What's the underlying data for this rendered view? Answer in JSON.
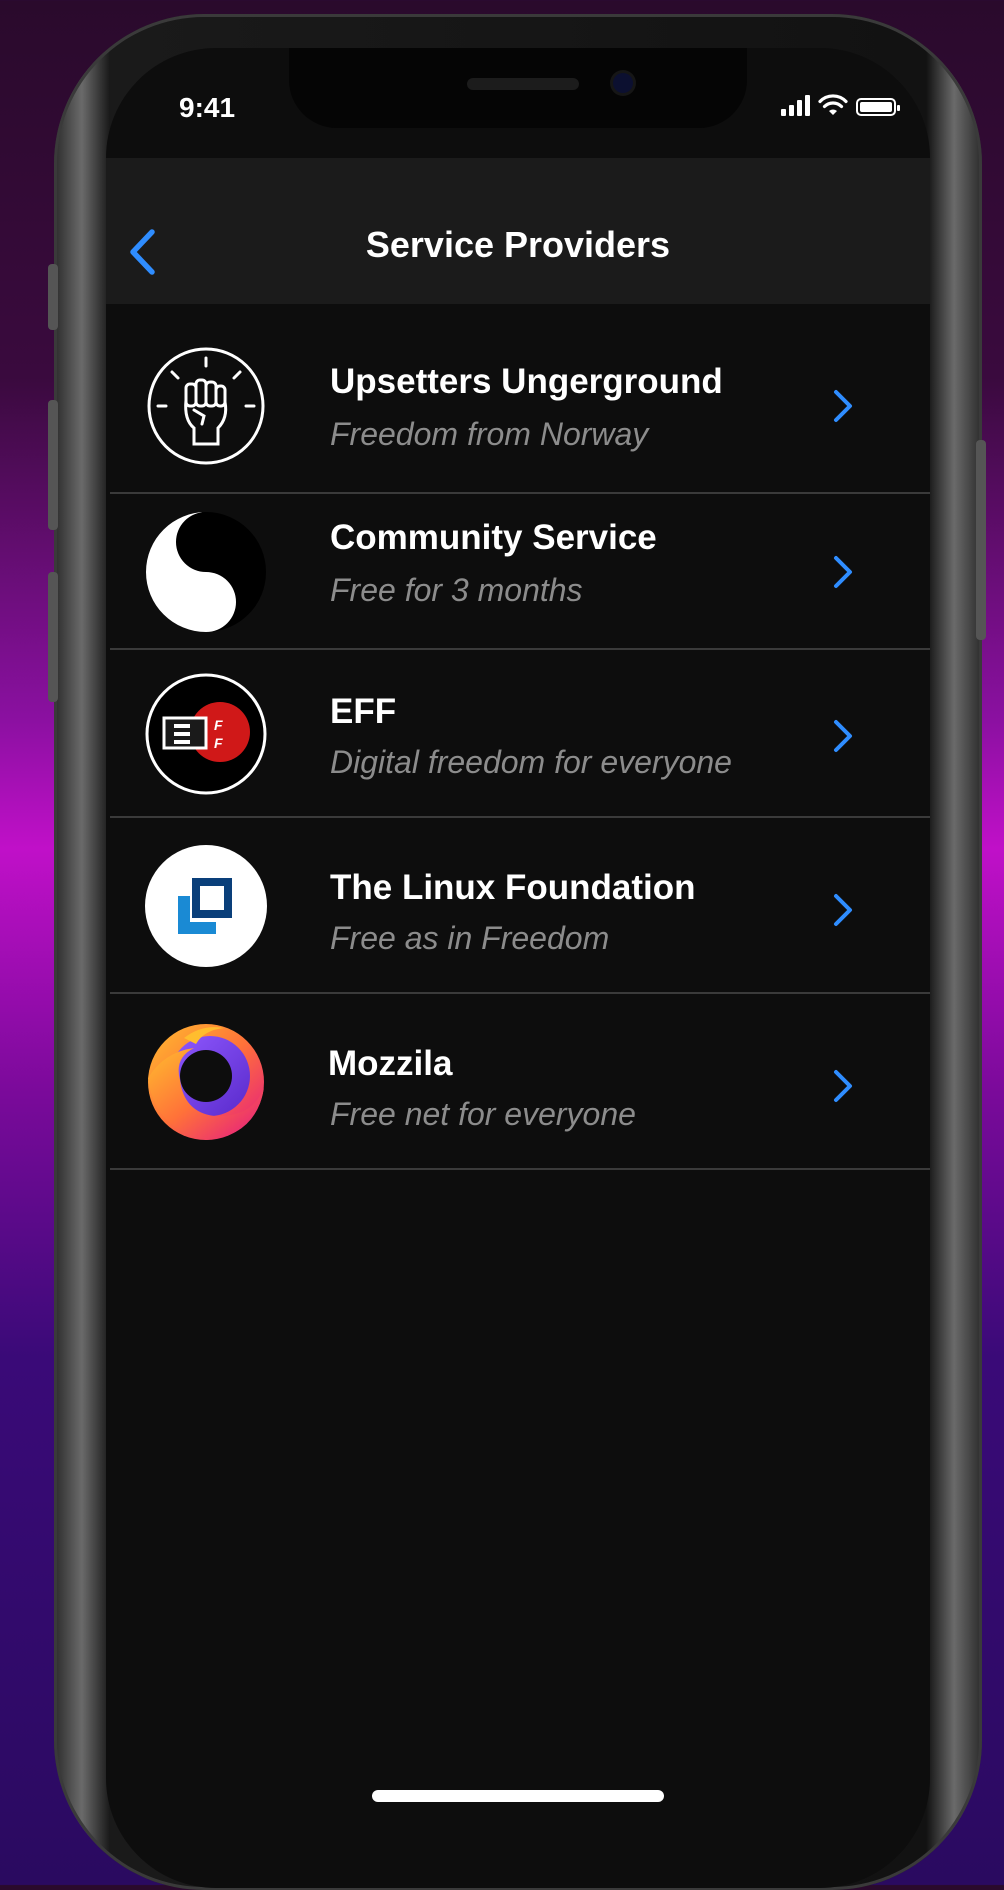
{
  "status_bar": {
    "time": "9:41"
  },
  "nav": {
    "title": "Service Providers",
    "back_icon": "chevron-left-icon"
  },
  "providers": [
    {
      "name": "Upsetters Ungerground",
      "tagline": "Freedom from Norway",
      "icon": "raised-fist-icon"
    },
    {
      "name": "Community Service",
      "tagline": "Free for 3 months",
      "icon": "yin-yang-icon"
    },
    {
      "name": "EFF",
      "tagline": "Digital freedom for everyone",
      "icon": "eff-logo-icon"
    },
    {
      "name": "The Linux Foundation",
      "tagline": "Free as in Freedom",
      "icon": "linux-foundation-logo-icon"
    },
    {
      "name": "Mozzila",
      "tagline": "Free net for everyone",
      "icon": "firefox-logo-icon"
    }
  ],
  "colors": {
    "accent": "#2f8dff",
    "background": "#0d0d0d",
    "navbar": "#1b1b1b"
  }
}
